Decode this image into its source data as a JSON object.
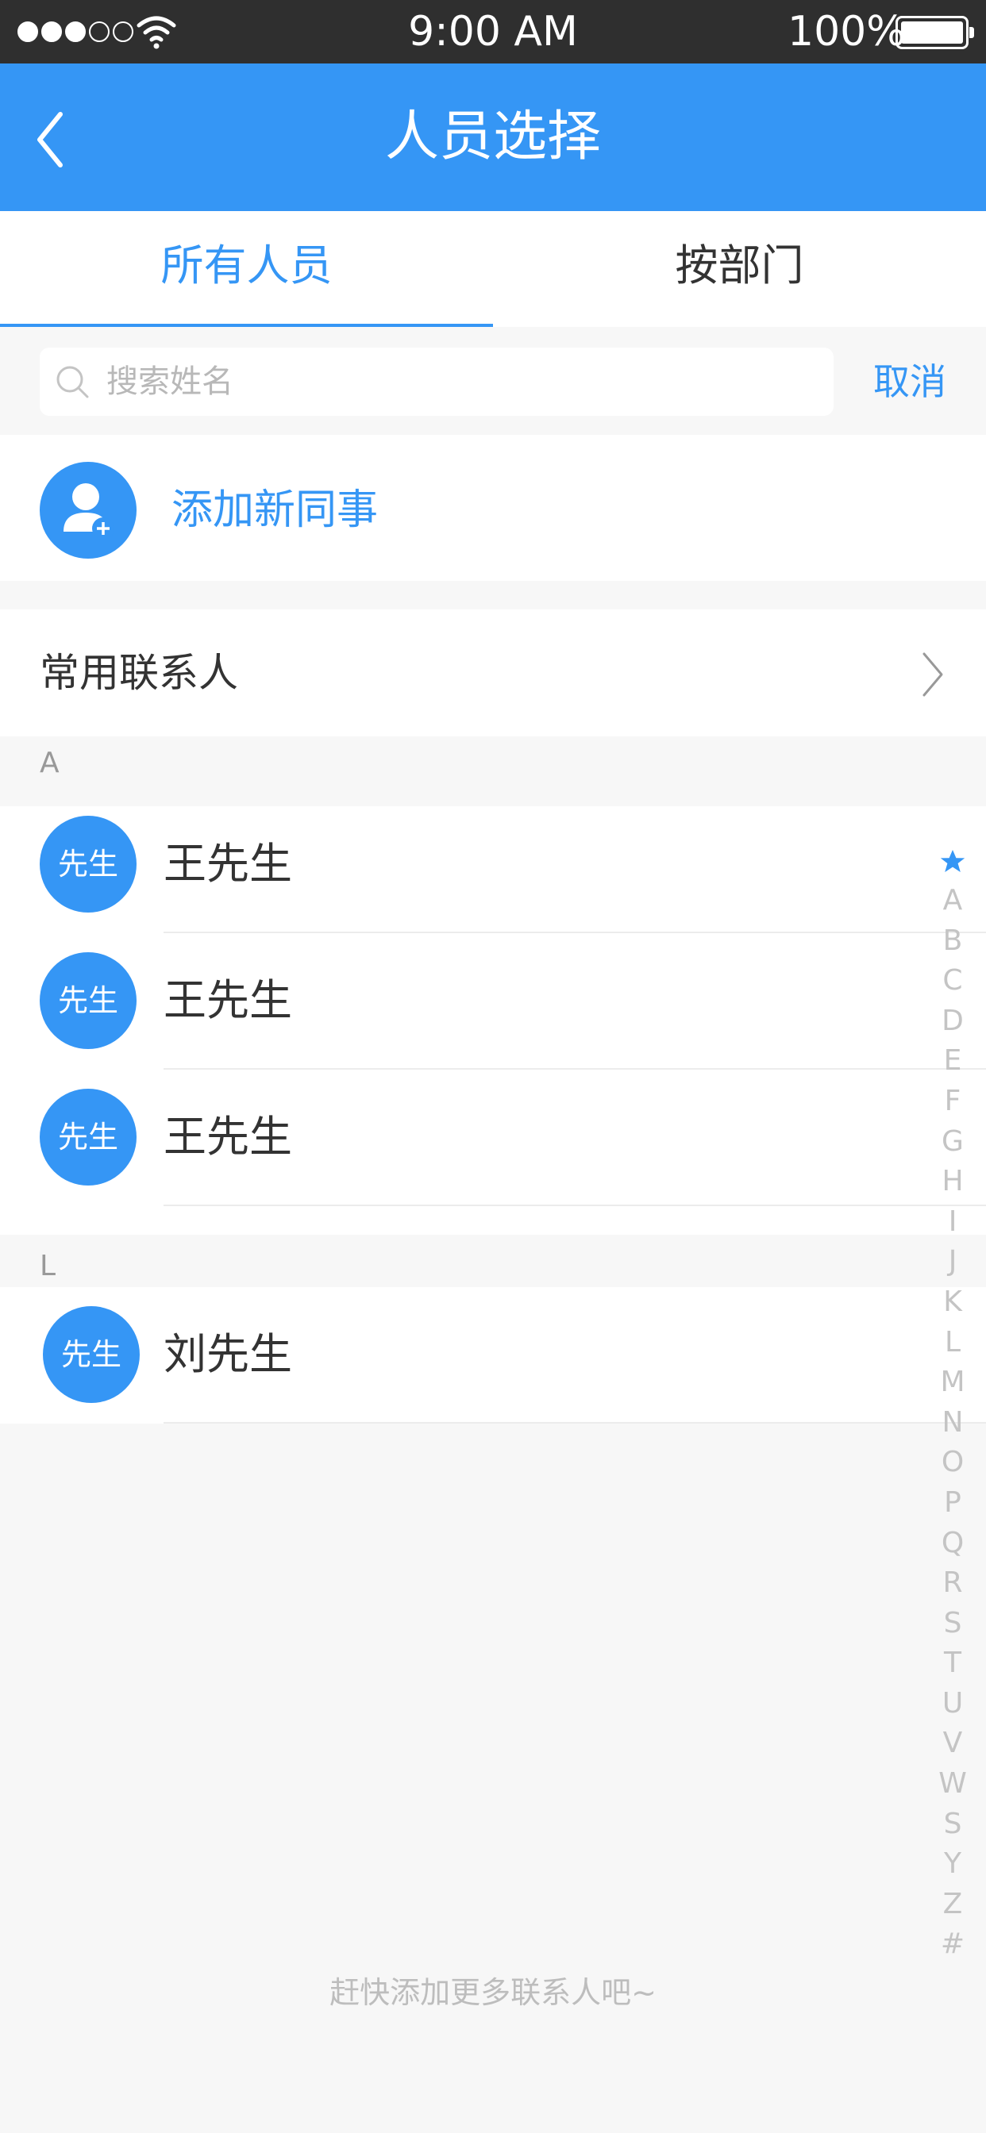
{
  "status_bar": {
    "time": "9:00 AM",
    "battery": "100%",
    "icons": [
      "signal-dots-icon",
      "wifi-icon",
      "battery-icon"
    ]
  },
  "nav": {
    "title": "人员选择",
    "back_icon": "chevron-left-icon"
  },
  "tabs": [
    {
      "label": "所有人员",
      "active": true
    },
    {
      "label": "按部门",
      "active": false
    }
  ],
  "search": {
    "placeholder": "搜索姓名",
    "value": "",
    "cancel_label": "取消",
    "icon": "search-icon"
  },
  "add_colleague": {
    "label": "添加新同事",
    "icon": "add-user-icon"
  },
  "favorites": {
    "label": "常用联系人",
    "icon": "chevron-right-icon"
  },
  "sections": [
    {
      "letter": "A",
      "contacts": [
        {
          "avatar_text": "先生",
          "name": "王先生"
        },
        {
          "avatar_text": "先生",
          "name": "王先生"
        },
        {
          "avatar_text": "先生",
          "name": "王先生"
        }
      ]
    },
    {
      "letter": "L",
      "contacts": [
        {
          "avatar_text": "先生",
          "name": "刘先生"
        }
      ]
    }
  ],
  "index_bar": [
    "A",
    "B",
    "C",
    "D",
    "E",
    "F",
    "G",
    "H",
    "I",
    "J",
    "K",
    "L",
    "M",
    "N",
    "O",
    "P",
    "Q",
    "R",
    "S",
    "T",
    "U",
    "V",
    "W",
    "S",
    "Y",
    "Z",
    "#"
  ],
  "empty_hint": "赶快添加更多联系人吧~",
  "colors": {
    "accent": "#3596f5",
    "status_bar": "#2f2f2f",
    "background": "#f7f7f7"
  }
}
